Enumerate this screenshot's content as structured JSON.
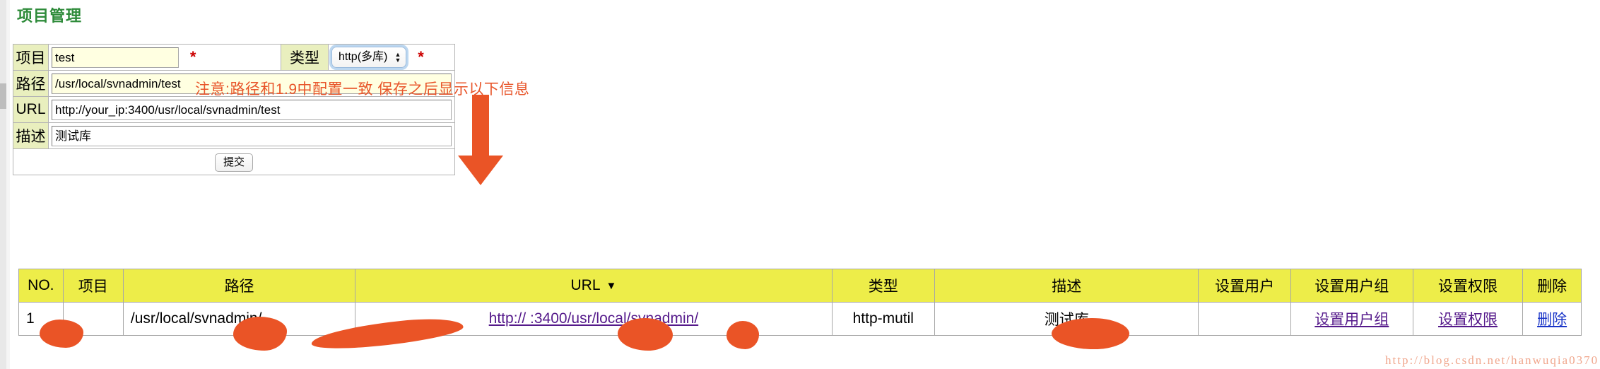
{
  "page": {
    "title": "项目管理",
    "watermark": "http://blog.csdn.net/hanwuqia0370"
  },
  "form": {
    "rows": [
      {
        "label": "项目",
        "value": "test",
        "required": "*"
      },
      {
        "label": "路径",
        "value": "/usr/local/svnadmin/test",
        "required": "*"
      },
      {
        "label": "URL",
        "value": "http://your_ip:3400/usr/local/svnadmin/test",
        "required": "*"
      },
      {
        "label": "描述",
        "value": "测试库",
        "required": ""
      }
    ],
    "type_label": "类型",
    "type_value": "http(多库)",
    "type_required": "*",
    "submit_label": "提交"
  },
  "annotation": {
    "text": "注意:路径和1.9中配置一致  保存之后显示以下信息",
    "color": "#e8552a"
  },
  "table": {
    "headers": [
      "NO.",
      "项目",
      "路径",
      "URL",
      "类型",
      "描述",
      "设置用户",
      "设置用户组",
      "设置权限",
      "删除"
    ],
    "sort_column": "URL",
    "sort_caret": "▼",
    "rows": [
      {
        "no": "1",
        "project": "",
        "path": "/usr/local/svnadmin/",
        "url": "http://                    :3400/usr/local/svnadmin/",
        "type": "http-mutil",
        "desc": "测试库",
        "set_user": "",
        "set_user_group": "设置用户组",
        "set_permission": "设置权限",
        "delete": "删除"
      }
    ]
  }
}
